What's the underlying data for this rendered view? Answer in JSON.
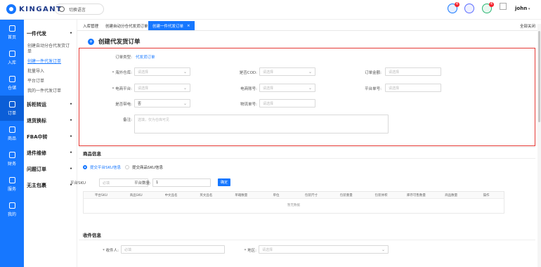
{
  "header": {
    "brand": "KINGANT",
    "language_label": "切换语言",
    "username": "john",
    "notification_badges": [
      "4",
      "4"
    ]
  },
  "rail": [
    {
      "label": "首页",
      "icon": "dashboard-icon"
    },
    {
      "label": "入库",
      "icon": "inbound-icon"
    },
    {
      "label": "仓储",
      "icon": "warehouse-icon"
    },
    {
      "label": "订单",
      "icon": "order-icon"
    },
    {
      "label": "商品",
      "icon": "product-icon"
    },
    {
      "label": "财务",
      "icon": "finance-icon"
    },
    {
      "label": "服务",
      "icon": "service-icon"
    },
    {
      "label": "我的",
      "icon": "user-icon"
    }
  ],
  "sidebar": {
    "group_main": "一件代发",
    "subs": [
      "创建自动分仓代发货订单",
      "创建一件代发订单",
      "批量导入",
      "平台订单",
      "我的一件代发订单"
    ],
    "groups": [
      "拆柜转运",
      "退货换标",
      "FBA中转",
      "退件维修",
      "问题订单",
      "无主包裹"
    ]
  },
  "tabs": [
    "入库管理",
    "创建自动分仓代发货订单",
    "创建一件代发订单"
  ],
  "close_all": "全部关闭",
  "page_title": "创建代发货订单",
  "form": {
    "order_type_label": "订单类型:",
    "order_type_value": "代发货订单",
    "warehouse_label": "* 海外仓库:",
    "warehouse_ph": "请选择",
    "cod_label": "是否COD:",
    "cod_ph": "请选择",
    "amount_label": "订单金额:",
    "amount_ph": "请选择",
    "platform_label": "* 电商平台:",
    "platform_ph": "请选择",
    "account_label": "电商账号:",
    "account_ph": "请选择",
    "platform_no_label": "平台单号:",
    "platform_no_ph": "请选择",
    "insured_label": "是否带电:",
    "insured_value": "否",
    "tracking_label": "物流单号:",
    "tracking_ph": "请选择",
    "remark_label": "备注:",
    "remark_ph": "选填，仅为仓库可见"
  },
  "goods": {
    "section": "商品信息",
    "radio_platform": "提交平台SKU信息",
    "radio_product": "提交商品SKU信息",
    "sku_label": "平台SKU",
    "sku_ph": "必填",
    "qty_label": "平台数量:",
    "qty_value": "1",
    "confirm": "确定",
    "columns": [
      "平台SKU",
      "商品SKU",
      "中文品名",
      "英文品名",
      "单箱数量",
      "单位",
      "包装尺寸",
      "包装重量",
      "包装体积",
      "库存可售数量",
      "商品数量",
      "操作"
    ],
    "empty": "暂无数据"
  },
  "receiver": {
    "section": "收件信息",
    "name_label": "* 收件人:",
    "name_ph": "必填",
    "region_label": "* 地区:",
    "region_ph": "请选择"
  }
}
